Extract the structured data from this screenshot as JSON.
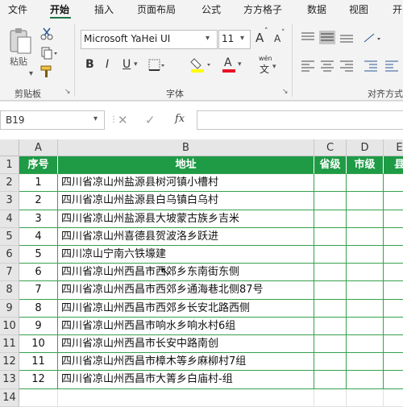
{
  "menu": {
    "file": "文件",
    "home": "开始",
    "insert": "插入",
    "page_layout": "页面布局",
    "formulas": "公式",
    "fangfang": "方方格子",
    "data": "数据",
    "view": "视图",
    "developer": "开"
  },
  "ribbon": {
    "paste_label": "粘贴",
    "clipboard_group": "剪贴板",
    "font_group": "字体",
    "alignment_group": "对齐方式",
    "font_name": "Microsoft YaHei UI",
    "font_size": "11",
    "bold": "B",
    "italic": "I",
    "underline": "U",
    "grow_font": "A",
    "shrink_font": "A",
    "font_color_letter": "A",
    "phonetic": "wén",
    "highlight_color": "#ffff00",
    "font_color": "#e81123"
  },
  "formula_bar": {
    "name_box": "B19",
    "fx": "fx",
    "content": ""
  },
  "sheet": {
    "columns": [
      "A",
      "B",
      "C",
      "D",
      "E"
    ],
    "rows": [
      "1",
      "2",
      "3",
      "4",
      "5",
      "6",
      "7",
      "8",
      "9",
      "10",
      "11",
      "12",
      "13",
      "14"
    ],
    "header": {
      "no": "序号",
      "address": "地址",
      "province": "省级",
      "city": "市级",
      "county": "县"
    },
    "records": [
      {
        "no": "1",
        "address": "四川省凉山州盐源县树河镇小槽村"
      },
      {
        "no": "2",
        "address": "四川省凉山州盐源县白乌镇白乌村"
      },
      {
        "no": "3",
        "address": "四川省凉山州盐源县大坡蒙古族乡吉米"
      },
      {
        "no": "4",
        "address": "四川省凉山州喜德县贺波洛乡跃进"
      },
      {
        "no": "5",
        "address": "四川凉山宁南六铁壕建"
      },
      {
        "no": "6",
        "address": "四川省凉山州西昌市西郊乡东南街东侧"
      },
      {
        "no": "7",
        "address": "四川省凉山州西昌市西郊乡通海巷北侧87号"
      },
      {
        "no": "8",
        "address": "四川省凉山州西昌市西郊乡长安北路西侧"
      },
      {
        "no": "9",
        "address": "四川省凉山州西昌市响水乡响水村6组"
      },
      {
        "no": "10",
        "address": "四川省凉山州西昌市长安中路南创"
      },
      {
        "no": "11",
        "address": "四川省凉山州西昌市樟木等乡麻柳村7组"
      },
      {
        "no": "12",
        "address": "四川省凉山州西昌市大箐乡白庙村-组"
      }
    ]
  },
  "colors": {
    "accent": "#217346",
    "header_fill": "#1f9b46",
    "grid_line": "#36a14e"
  }
}
